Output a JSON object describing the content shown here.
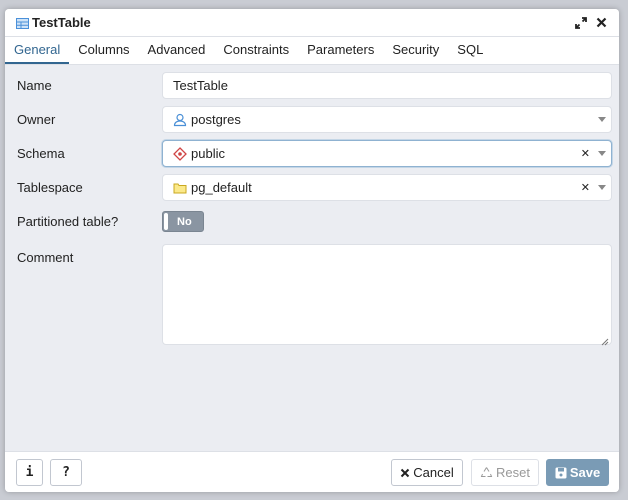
{
  "dialog": {
    "title": "TestTable",
    "title_icon": "table-icon",
    "maximize_icon": "expand-icon",
    "close_icon": "close-icon"
  },
  "tabs": [
    {
      "label": "General",
      "active": true
    },
    {
      "label": "Columns"
    },
    {
      "label": "Advanced"
    },
    {
      "label": "Constraints"
    },
    {
      "label": "Parameters"
    },
    {
      "label": "Security"
    },
    {
      "label": "SQL"
    }
  ],
  "form": {
    "name": {
      "label": "Name",
      "value": "TestTable"
    },
    "owner": {
      "label": "Owner",
      "value": "postgres",
      "icon": "user-icon"
    },
    "schema": {
      "label": "Schema",
      "value": "public",
      "icon": "schema-icon"
    },
    "tablespace": {
      "label": "Tablespace",
      "value": "pg_default",
      "icon": "folder-icon"
    },
    "partitioned": {
      "label": "Partitioned table?",
      "value": "No"
    },
    "comment": {
      "label": "Comment",
      "value": ""
    }
  },
  "footer": {
    "info_label": "i",
    "help_label": "?",
    "cancel_label": "Cancel",
    "reset_label": "Reset",
    "save_label": "Save"
  },
  "colors": {
    "accent": "#326690",
    "save_button": "#7a9bb5",
    "toggle_off": "#8a95a2"
  }
}
